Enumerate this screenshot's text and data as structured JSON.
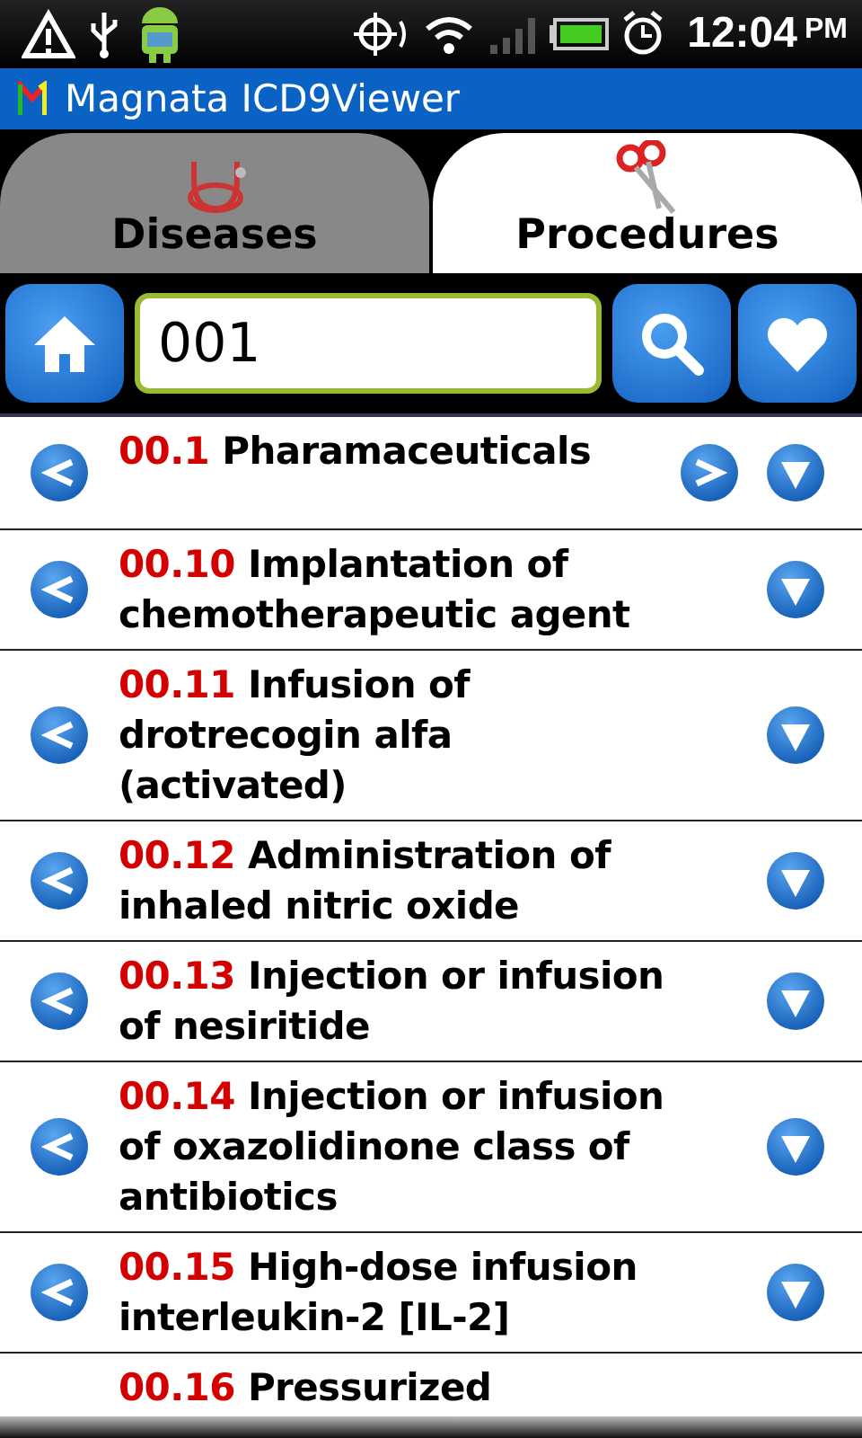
{
  "status_bar": {
    "time": "12:04",
    "ampm": "PM"
  },
  "window": {
    "title": "Magnata ICD9Viewer"
  },
  "tabs": [
    {
      "label": "Diseases",
      "kind": "stethoscope",
      "selected": false
    },
    {
      "label": "Procedures",
      "kind": "scissors",
      "selected": true
    }
  ],
  "search": {
    "value": "001"
  },
  "items": [
    {
      "code": "00.1",
      "title": "Pharamaceuticals",
      "has_children": true,
      "cut": false
    },
    {
      "code": "00.10",
      "title": "Implantation of chemotherapeutic agent",
      "has_children": false,
      "cut": false
    },
    {
      "code": "00.11",
      "title": "Infusion of drotrecogin alfa (activated)",
      "has_children": false,
      "cut": false
    },
    {
      "code": "00.12",
      "title": "Administration of inhaled nitric oxide",
      "has_children": false,
      "cut": false
    },
    {
      "code": "00.13",
      "title": "Injection or infusion of nesiritide",
      "has_children": false,
      "cut": false
    },
    {
      "code": "00.14",
      "title": "Injection or infusion of oxazolidinone class of antibiotics",
      "has_children": false,
      "cut": false
    },
    {
      "code": "00.15",
      "title": "High-dose infusion interleukin-2 [IL-2]",
      "has_children": false,
      "cut": false
    },
    {
      "code": "00.16",
      "title": "Pressurized",
      "has_children": false,
      "cut": true
    }
  ]
}
